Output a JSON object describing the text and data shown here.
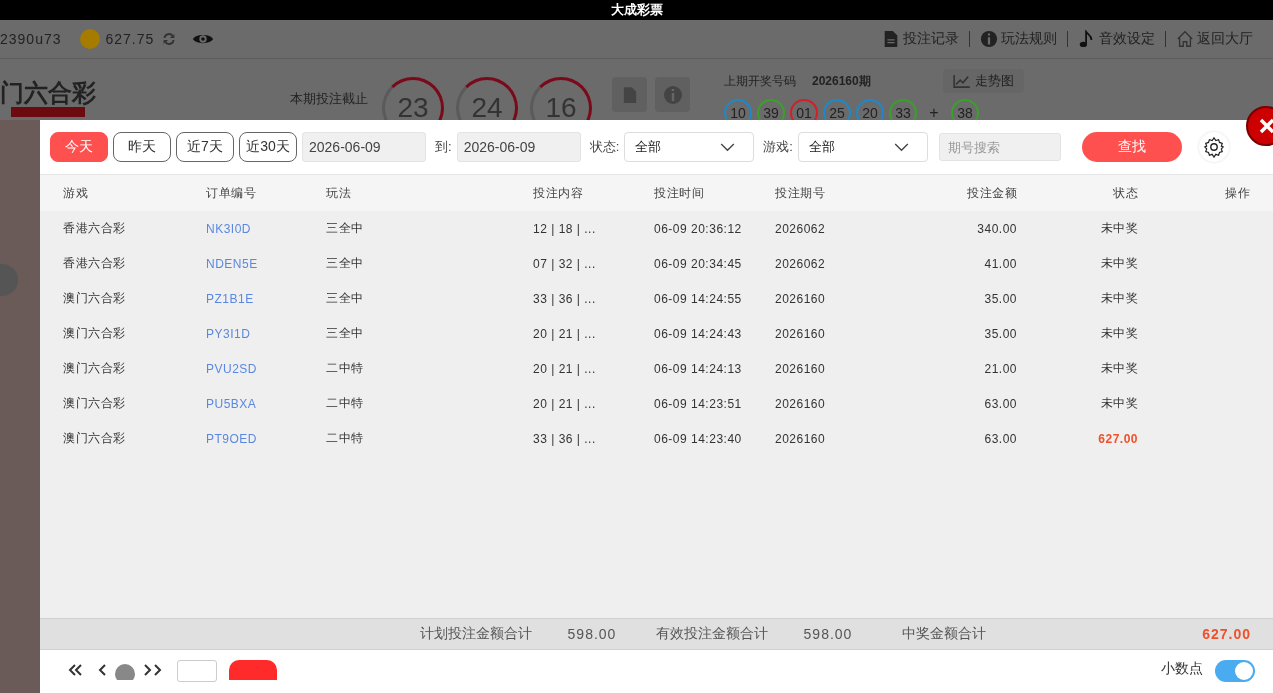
{
  "app_title": "大成彩票",
  "topbar": {
    "user": "2390u73",
    "balance": "627.75",
    "links": [
      {
        "label": "投注记录"
      },
      {
        "label": "玩法规则"
      },
      {
        "label": "音效设定"
      },
      {
        "label": "返回大厅"
      }
    ]
  },
  "lottery": {
    "name": "门六合彩",
    "deadline_label": "本期投注截止",
    "countdown": [
      "23",
      "24",
      "16"
    ],
    "last_label": "上期开奖号码",
    "last_period": "2026160期",
    "trend": "走势图",
    "plus": "+",
    "balls": [
      {
        "n": "10",
        "color": "#1e88c8"
      },
      {
        "n": "39",
        "color": "#3aa02a"
      },
      {
        "n": "01",
        "color": "#d2202a"
      },
      {
        "n": "25",
        "color": "#1e88c8"
      },
      {
        "n": "20",
        "color": "#1e88c8"
      },
      {
        "n": "33",
        "color": "#3aa02a"
      }
    ],
    "special": {
      "n": "38",
      "color": "#3aa02a"
    }
  },
  "filters": {
    "ranges": [
      {
        "label": "今天",
        "selected": true
      },
      {
        "label": "昨天",
        "selected": false
      },
      {
        "label": "近7天",
        "selected": false
      },
      {
        "label": "近30天",
        "selected": false
      }
    ],
    "date_from": "2026-06-09",
    "to_label": "到:",
    "date_to": "2026-06-09",
    "status_label": "状态:",
    "status_value": "全部",
    "game_label": "游戏:",
    "game_value": "全部",
    "search_placeholder": "期号搜索",
    "search_button": "查找"
  },
  "table": {
    "columns": [
      "游戏",
      "订单编号",
      "玩法",
      "投注内容",
      "投注时间",
      "投注期号",
      "投注金额",
      "状态",
      "操作"
    ],
    "rows": [
      {
        "game": "香港六合彩",
        "order": "NK3I0D",
        "play": "三全中",
        "content": "12 | 18 | ...",
        "time": "06-09 20:36:12",
        "period": "2026062",
        "amount": "340.00",
        "status": "未中奖",
        "won": false
      },
      {
        "game": "香港六合彩",
        "order": "NDEN5E",
        "play": "三全中",
        "content": "07 | 32 | ...",
        "time": "06-09 20:34:45",
        "period": "2026062",
        "amount": "41.00",
        "status": "未中奖",
        "won": false
      },
      {
        "game": "澳门六合彩",
        "order": "PZ1B1E",
        "play": "三全中",
        "content": "33 | 36 | ...",
        "time": "06-09 14:24:55",
        "period": "2026160",
        "amount": "35.00",
        "status": "未中奖",
        "won": false
      },
      {
        "game": "澳门六合彩",
        "order": "PY3I1D",
        "play": "三全中",
        "content": "20 | 21 | ...",
        "time": "06-09 14:24:43",
        "period": "2026160",
        "amount": "35.00",
        "status": "未中奖",
        "won": false
      },
      {
        "game": "澳门六合彩",
        "order": "PVU2SD",
        "play": "二中特",
        "content": "20 | 21 | ...",
        "time": "06-09 14:24:13",
        "period": "2026160",
        "amount": "21.00",
        "status": "未中奖",
        "won": false
      },
      {
        "game": "澳门六合彩",
        "order": "PU5BXA",
        "play": "二中特",
        "content": "20 | 21 | ...",
        "time": "06-09 14:23:51",
        "period": "2026160",
        "amount": "63.00",
        "status": "未中奖",
        "won": false
      },
      {
        "game": "澳门六合彩",
        "order": "PT9OED",
        "play": "二中特",
        "content": "33 | 36 | ...",
        "time": "06-09 14:23:40",
        "period": "2026160",
        "amount": "63.00",
        "status": "627.00",
        "won": true
      }
    ]
  },
  "totals": [
    {
      "label": "计划投注金额合计",
      "value": "598.00",
      "highlight": false
    },
    {
      "label": "有效投注金额合计",
      "value": "598.00",
      "highlight": false
    },
    {
      "label": "中奖金额合计",
      "value": "627.00",
      "highlight": true
    }
  ],
  "decimal_toggle": {
    "label": "小数点",
    "on": true
  }
}
